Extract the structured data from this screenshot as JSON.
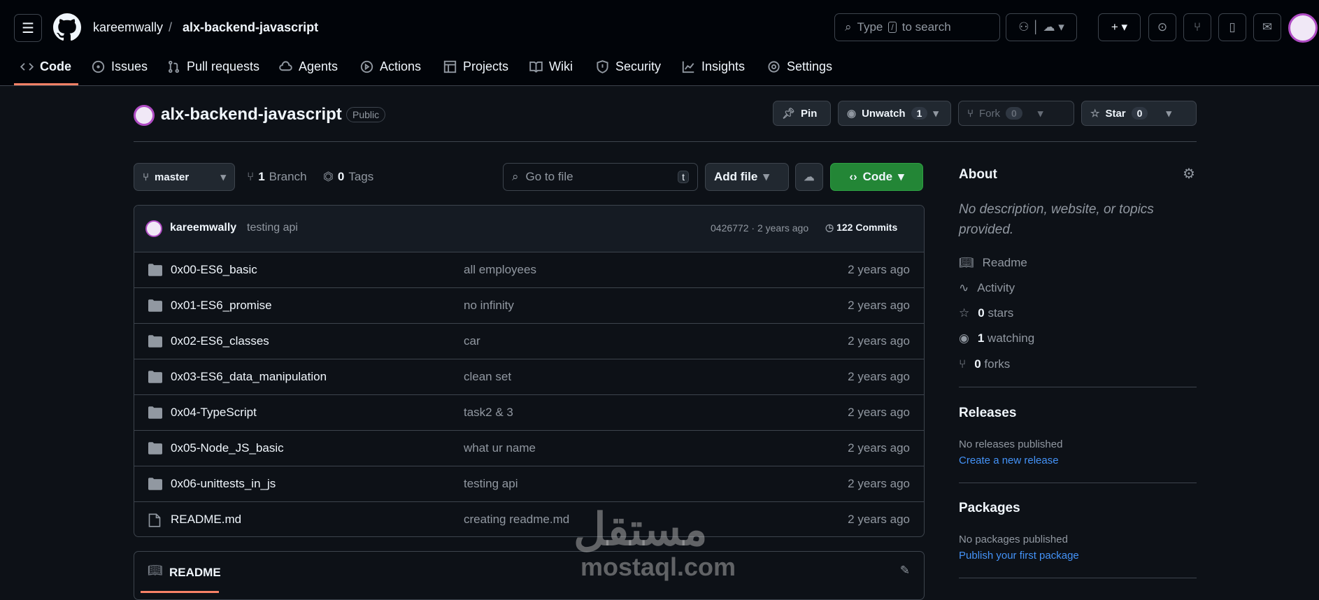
{
  "header": {
    "owner": "kareemwally",
    "separator": "/",
    "repo": "alx-backend-javascript",
    "search_prefix": "Type",
    "search_key": "/",
    "search_suffix": "to search"
  },
  "tabs": [
    {
      "label": "Code"
    },
    {
      "label": "Issues"
    },
    {
      "label": "Pull requests"
    },
    {
      "label": "Agents"
    },
    {
      "label": "Actions"
    },
    {
      "label": "Projects"
    },
    {
      "label": "Wiki"
    },
    {
      "label": "Security"
    },
    {
      "label": "Insights"
    },
    {
      "label": "Settings"
    }
  ],
  "repo": {
    "name": "alx-backend-javascript",
    "visibility": "Public",
    "pin": "Pin",
    "unwatch": "Unwatch",
    "watch_count": "1",
    "fork": "Fork",
    "fork_count": "0",
    "star": "Star",
    "star_count": "0"
  },
  "toolbar": {
    "branch": "master",
    "branches_n": "1",
    "branches_label": "Branch",
    "tags_n": "0",
    "tags_label": "Tags",
    "goto_placeholder": "Go to file",
    "goto_key": "t",
    "add_file": "Add file",
    "code": "Code"
  },
  "commit": {
    "author": "kareemwally",
    "message": "testing api",
    "hash_time": "0426772 · 2 years ago",
    "commits": "122 Commits"
  },
  "files": [
    {
      "name": "0x00-ES6_basic",
      "type": "folder",
      "message": "all employees",
      "time": "2 years ago"
    },
    {
      "name": "0x01-ES6_promise",
      "type": "folder",
      "message": "no infinity",
      "time": "2 years ago"
    },
    {
      "name": "0x02-ES6_classes",
      "type": "folder",
      "message": "car",
      "time": "2 years ago"
    },
    {
      "name": "0x03-ES6_data_manipulation",
      "type": "folder",
      "message": "clean set",
      "time": "2 years ago"
    },
    {
      "name": "0x04-TypeScript",
      "type": "folder",
      "message": "task2 & 3",
      "time": "2 years ago"
    },
    {
      "name": "0x05-Node_JS_basic",
      "type": "folder",
      "message": "what ur name",
      "time": "2 years ago"
    },
    {
      "name": "0x06-unittests_in_js",
      "type": "folder",
      "message": "testing api",
      "time": "2 years ago"
    },
    {
      "name": "README.md",
      "type": "file",
      "message": "creating readme.md",
      "time": "2 years ago"
    }
  ],
  "readme": {
    "title": "README"
  },
  "about": {
    "title": "About",
    "description": "No description, website, or topics provided.",
    "readme": "Readme",
    "activity": "Activity",
    "stars_n": "0",
    "stars": "stars",
    "watching_n": "1",
    "watching": "watching",
    "forks_n": "0",
    "forks": "forks"
  },
  "releases": {
    "title": "Releases",
    "empty": "No releases published",
    "link": "Create a new release"
  },
  "packages": {
    "title": "Packages",
    "empty": "No packages published",
    "link": "Publish your first package"
  },
  "watermark": {
    "arabic": "مستقل",
    "latin": "mostaql.com"
  }
}
